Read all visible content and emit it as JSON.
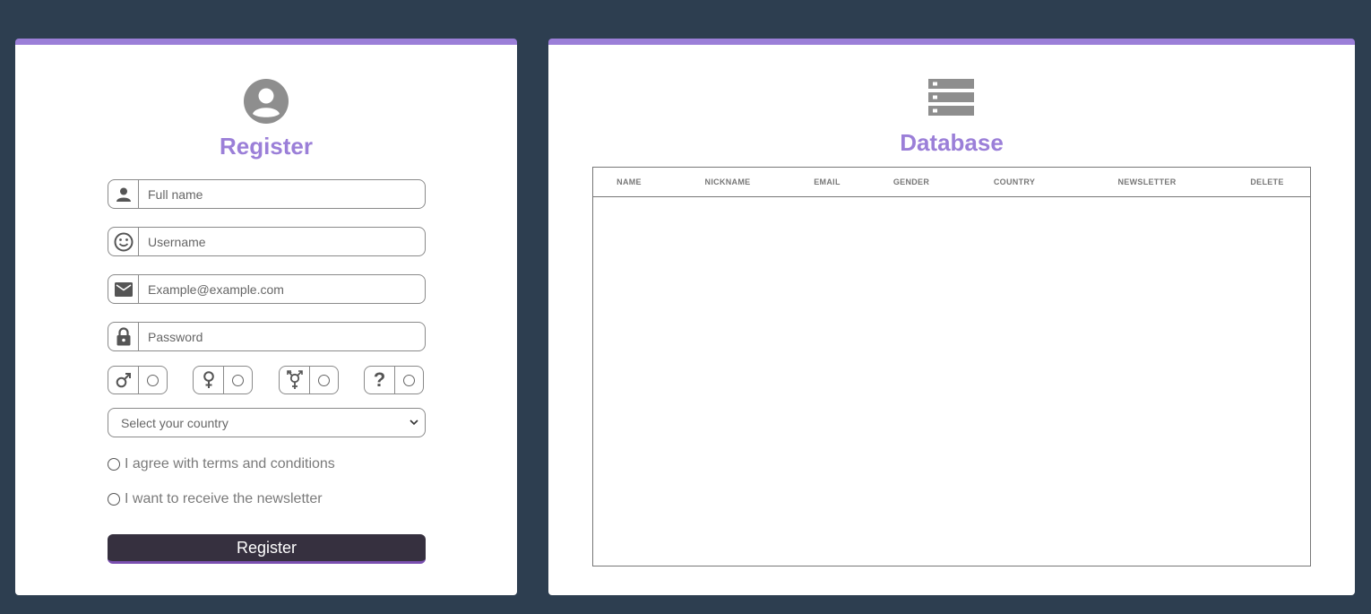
{
  "register": {
    "title": "Register",
    "fields": {
      "fullname": {
        "placeholder": "Full name",
        "icon": "person-icon"
      },
      "username": {
        "placeholder": "Username",
        "icon": "smiley-icon"
      },
      "email": {
        "placeholder": "Example@example.com",
        "icon": "envelope-icon"
      },
      "password": {
        "placeholder": "Password",
        "icon": "lock-icon"
      }
    },
    "genders": [
      {
        "icon": "male-icon",
        "glyph": "♂"
      },
      {
        "icon": "female-icon",
        "glyph": "♀"
      },
      {
        "icon": "transgender-icon",
        "glyph": "⚧"
      },
      {
        "icon": "question-icon",
        "glyph": "?"
      }
    ],
    "country_select": {
      "placeholder": "Select your country"
    },
    "terms_label": "I agree with terms and conditions",
    "newsletter_label": "I want to receive the newsletter",
    "button_label": "Register"
  },
  "database": {
    "title": "Database",
    "columns": [
      "NAME",
      "NICKNAME",
      "EMAIL",
      "GENDER",
      "COUNTRY",
      "NEWSLETTER",
      "DELETE"
    ],
    "rows": []
  },
  "colors": {
    "background": "#2d3e50",
    "accent": "#9b7fd8",
    "button": "#36303f",
    "icon": "#555555"
  }
}
